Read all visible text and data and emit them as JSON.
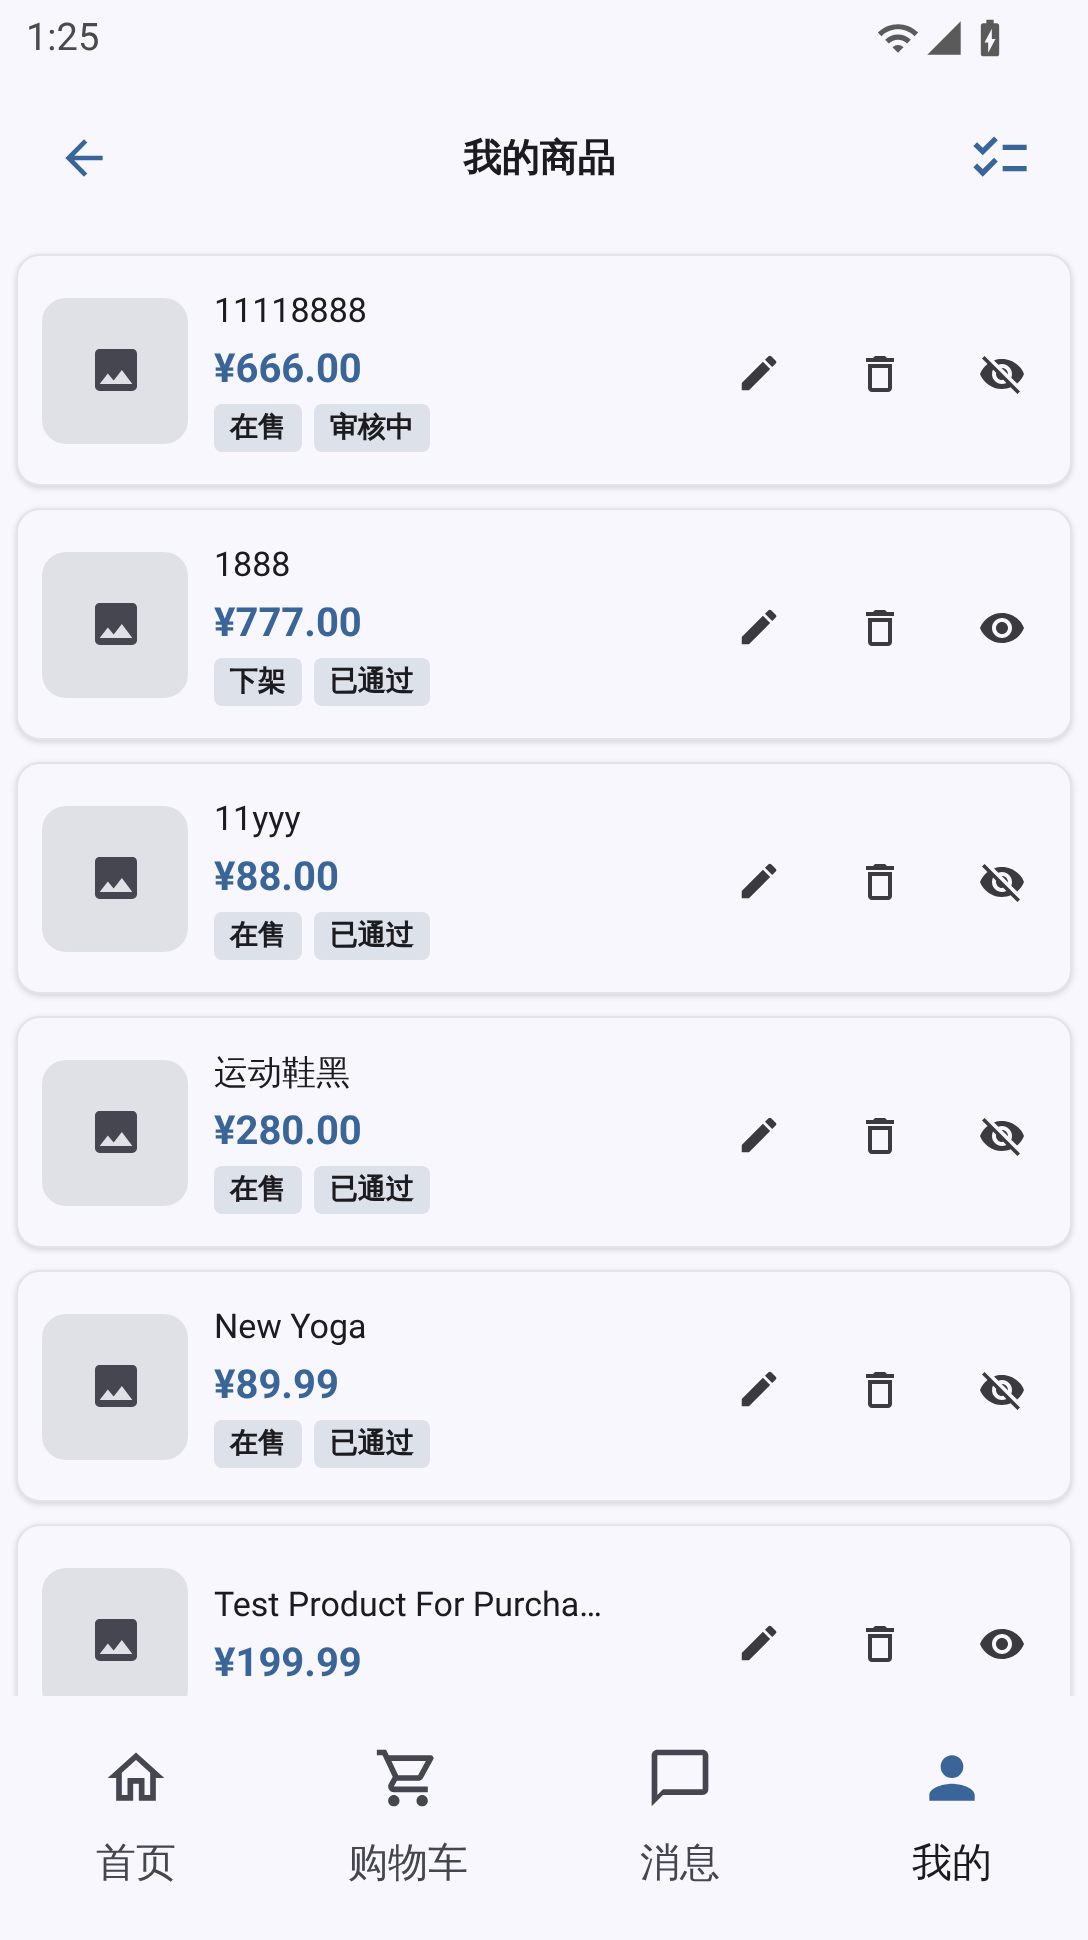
{
  "status_bar": {
    "time": "1:25"
  },
  "app_bar": {
    "title": "我的商品"
  },
  "products": [
    {
      "name": "11118888",
      "price": "¥666.00",
      "tags": [
        "在售",
        "审核中"
      ],
      "hidden": false
    },
    {
      "name": "1888",
      "price": "¥777.00",
      "tags": [
        "下架",
        "已通过"
      ],
      "hidden": true
    },
    {
      "name": "11yyy",
      "price": "¥88.00",
      "tags": [
        "在售",
        "已通过"
      ],
      "hidden": false
    },
    {
      "name": "运动鞋黑",
      "price": "¥280.00",
      "tags": [
        "在售",
        "已通过"
      ],
      "hidden": false
    },
    {
      "name": "New Yoga",
      "price": "¥89.99",
      "tags": [
        "在售",
        "已通过"
      ],
      "hidden": false
    },
    {
      "name": "Test Product For Purcha…",
      "price": "¥199.99",
      "hidden": true
    }
  ],
  "bottom_nav": [
    {
      "label": "首页",
      "kind": "home",
      "selected": false
    },
    {
      "label": "购物车",
      "kind": "cart",
      "selected": false
    },
    {
      "label": "消息",
      "kind": "messages",
      "selected": false
    },
    {
      "label": "我的",
      "kind": "profile",
      "selected": true
    }
  ]
}
